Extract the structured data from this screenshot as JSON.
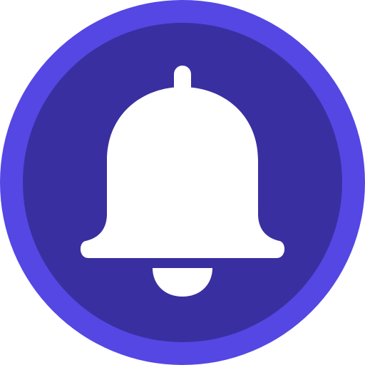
{
  "icon": {
    "name": "notification-bell-icon",
    "colors": {
      "outer_ring": "#5447E4",
      "inner_disc": "#3A2FA0",
      "glyph": "#FFFFFF"
    }
  }
}
